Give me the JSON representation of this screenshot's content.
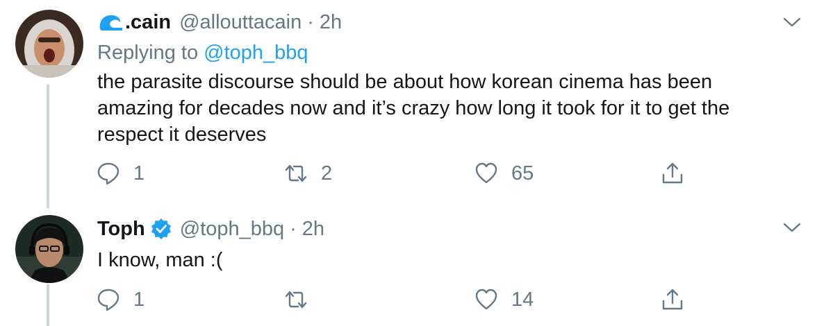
{
  "tweets": [
    {
      "display_name": ".cain",
      "handle": "@allouttacain",
      "separator": "·",
      "time": "2h",
      "reply_prefix": "Replying to",
      "reply_mention": "@toph_bbq",
      "text_lines": [
        "the parasite discourse should be about how  korean cinema has been",
        "amazing for decades now and it’s crazy how long it took for it to get the",
        "respect it deserves"
      ],
      "replies": "1",
      "retweets": "2",
      "likes": "65",
      "avatar_icon": "avatar-hooded-man",
      "name_icon": "wave-icon"
    },
    {
      "display_name": "Toph",
      "verified": true,
      "handle": "@toph_bbq",
      "separator": "·",
      "time": "2h",
      "text": "I know, man :(",
      "replies": "1",
      "retweets": "",
      "likes": "14",
      "avatar_icon": "avatar-headset-gamer"
    }
  ],
  "colors": {
    "text": "#14171a",
    "secondary": "#657786",
    "link": "#1da1f2",
    "thread_line": "#ccd6dd",
    "verified": "#1da1f2"
  }
}
